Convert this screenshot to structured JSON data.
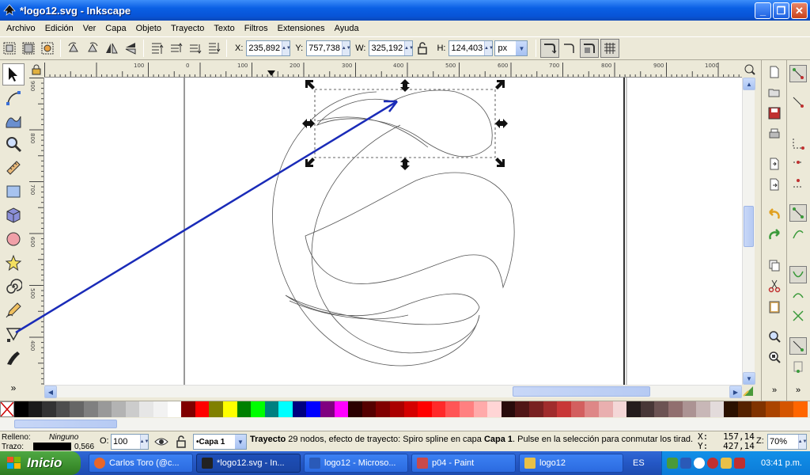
{
  "window": {
    "title": "*logo12.svg - Inkscape",
    "min": "_",
    "max": "❐",
    "close": "✕"
  },
  "menu": [
    "Archivo",
    "Edición",
    "Ver",
    "Capa",
    "Objeto",
    "Trayecto",
    "Texto",
    "Filtros",
    "Extensiones",
    "Ayuda"
  ],
  "controls": {
    "x_label": "X:",
    "x_value": "235,892",
    "y_label": "Y:",
    "y_value": "757,738",
    "w_label": "W:",
    "w_value": "325,192",
    "h_label": "H:",
    "h_value": "124,403",
    "unit": "px"
  },
  "ruler": {
    "top_labels": [
      "100",
      "0",
      "100",
      "200",
      "300",
      "400",
      "500",
      "600",
      "700",
      "800",
      "900",
      "1000"
    ],
    "left_labels": [
      "900",
      "800",
      "700",
      "600",
      "500",
      "400",
      "300"
    ]
  },
  "palette_colors": [
    "#000000",
    "#1a1a1a",
    "#333333",
    "#4d4d4d",
    "#666666",
    "#808080",
    "#999999",
    "#b3b3b3",
    "#cccccc",
    "#e6e6e6",
    "#f2f2f2",
    "#ffffff",
    "#800000",
    "#ff0000",
    "#808000",
    "#ffff00",
    "#008000",
    "#00ff00",
    "#008080",
    "#00ffff",
    "#000080",
    "#0000ff",
    "#800080",
    "#ff00ff",
    "#2b0000",
    "#550000",
    "#800000",
    "#aa0000",
    "#d40000",
    "#ff0000",
    "#ff2a2a",
    "#ff5555",
    "#ff8080",
    "#ffaaaa",
    "#ffd5d5",
    "#280b0b",
    "#501616",
    "#782121",
    "#a02c2c",
    "#c83737",
    "#d35f5f",
    "#de8787",
    "#e9afaf",
    "#f4d7d7",
    "#241c1c",
    "#483737",
    "#6c5353",
    "#916f6f",
    "#ac9393",
    "#c8b7b7",
    "#e3dbdb",
    "#2b1100",
    "#552200",
    "#803300",
    "#aa4400",
    "#d45500",
    "#ff6600"
  ],
  "status": {
    "fill_label": "Relleno:",
    "fill_value": "Ninguno",
    "stroke_label": "Trazo:",
    "stroke_width": "0,566",
    "opacity_label": "O:",
    "opacity_value": "100",
    "layer": "•Capa 1",
    "message_bold": "Trayecto",
    "message": " 29 nodos, efecto de trayecto: Spiro spline en capa ",
    "message_layer": "Capa 1",
    "message_tail": ". Pulse en la selección para conmutar los tirad...",
    "x_label": "X:",
    "x_value": "157,14",
    "y_label": "Y:",
    "y_value": "427,14",
    "zoom_label": "Z:",
    "zoom_value": "70%"
  },
  "taskbar": {
    "start": "Inicio",
    "tasks": [
      {
        "label": "Carlos Toro (@c...",
        "icon_color": "#e8662a",
        "icon": "firefox-icon"
      },
      {
        "label": "*logo12.svg - In...",
        "icon_color": "#222222",
        "icon": "inkscape-icon",
        "active": true
      },
      {
        "label": "logo12 - Microso...",
        "icon_color": "#2a5ab8",
        "icon": "word-icon"
      },
      {
        "label": "p04 - Paint",
        "icon_color": "#c84a4a",
        "icon": "paint-icon"
      },
      {
        "label": "logo12",
        "icon_color": "#e8c048",
        "icon": "folder-icon"
      }
    ],
    "lang": "ES",
    "clock": "03:41 p.m."
  }
}
